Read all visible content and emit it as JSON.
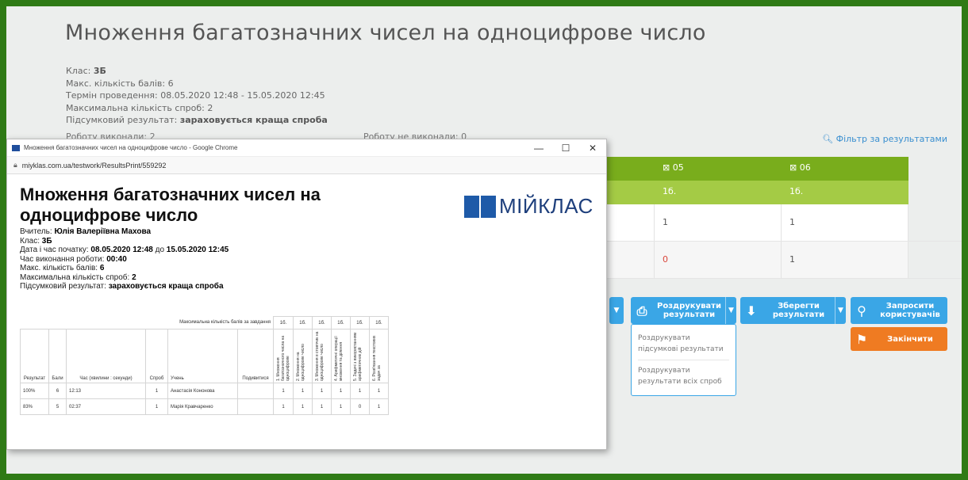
{
  "page": {
    "title": "Множення багатозначних чисел на одноцифрове число",
    "info": {
      "class_label": "Клас:",
      "class_value": "3Б",
      "max_points_label": "Макс. кількість балів:",
      "max_points_value": "6",
      "period_label": "Термін проведення:",
      "period_value": "08.05.2020 12:48 - 15.05.2020 12:45",
      "attempts_label": "Максимальна кількість спроб:",
      "attempts_value": "2",
      "result_label": "Підсумковий результат:",
      "result_value": "зараховується краща спроба"
    },
    "done_count": "Роботу виконали: 2",
    "not_done_count": "Роботу не виконали: 0",
    "filter_link": "Фільтр за результатами",
    "grid": {
      "headers": [
        "05",
        "06"
      ],
      "max_points": [
        "1б.",
        "1б."
      ],
      "rows": [
        [
          "1",
          "1"
        ],
        [
          "0",
          "1"
        ]
      ]
    },
    "buttons": {
      "print": "Роздрукувати результати",
      "save": "Зберегти результати",
      "invite": "Запросити користувачів",
      "finish": "Закінчити"
    },
    "print_menu": [
      "Роздрукувати підсумкові результати",
      "Роздрукувати результати всіх спроб"
    ]
  },
  "window": {
    "title": "Множення багатозначних чисел на одноцифрове число - Google Chrome",
    "url": "miyklas.com.ua/testwork/ResultsPrint/559292",
    "controls": [
      "—",
      "☐",
      "✕"
    ]
  },
  "doc": {
    "title": "Множення багатозначних чисел на одноцифрове число",
    "brand": "МІЙКЛАС",
    "teacher_label": "Вчитель:",
    "teacher_value": "Юлія Валеріївна Махова",
    "class_label": "Клас:",
    "class_value": "3Б",
    "start_label": "Дата і час початку:",
    "start_value": "08.05.2020 12:48",
    "to_label": "до",
    "end_value": "15.05.2020 12:45",
    "duration_label": "Час виконання роботи:",
    "duration_value": "00:40",
    "max_points_label": "Макс. кількість балів:",
    "max_points_value": "6",
    "attempts_label": "Максимальна кількість спроб:",
    "attempts_value": "2",
    "result_label": "Підсумковий результат:",
    "result_value": "зараховується краща спроба",
    "table": {
      "max_label": "Максимальна кількість балів за завдання",
      "max_values": [
        "1б.",
        "1б.",
        "1б.",
        "1б.",
        "1б.",
        "1б."
      ],
      "columns": [
        "Результат",
        "Бали",
        "Час (хвилини : секунди)",
        "Спроб",
        "Учень",
        "Подивитися"
      ],
      "tasks": [
        "1. Множення багатозначного числа на одноцифрове",
        "2. Множення на одноцифрове число",
        "3. Множення в стовпчик на одноцифрове число",
        "4. Арифметичні операції множення та ділення",
        "5. Задачі з використанням арифметичних дій",
        "6. Розв'язання текстових задач за"
      ],
      "rows": [
        {
          "result": "100%",
          "points": "6",
          "time": "12:13",
          "attempts": "1",
          "student": "Анастасія Кононова",
          "scores": [
            "1",
            "1",
            "1",
            "1",
            "1",
            "1"
          ]
        },
        {
          "result": "83%",
          "points": "5",
          "time": "02:37",
          "attempts": "1",
          "student": "Марія Кравчаренко",
          "scores": [
            "1",
            "1",
            "1",
            "1",
            "0",
            "1"
          ]
        }
      ]
    }
  },
  "colors": {
    "frame": "#2f7a16",
    "header_dark": "#79ad1c",
    "header_light": "#a4cb45",
    "button_blue": "#3aa6e6",
    "button_orange": "#ef7b22",
    "brand_blue": "#1e5aa8"
  }
}
